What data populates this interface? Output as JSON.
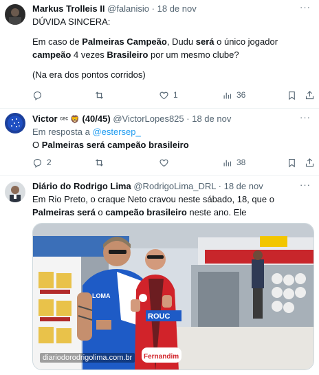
{
  "tweets": [
    {
      "author_name": "Markus Trolleis II",
      "handle": "@falanisio",
      "date": "18 de nov",
      "body_line1": "DÚVIDA SINCERA:",
      "body_p2_a": "Em caso de ",
      "body_p2_b": "Palmeiras Campeão",
      "body_p2_c": ", Dudu ",
      "body_p2_d": "será",
      "body_p2_e": " o único jogador ",
      "body_p2_f": "campeão",
      "body_p2_g": " 4 vezes ",
      "body_p2_h": "Brasileiro",
      "body_p2_i": " por um mesmo clube?",
      "body_p3": "(Na era dos pontos corridos)",
      "replies": "",
      "retweets": "",
      "likes": "1",
      "views": "36"
    },
    {
      "author_name": "Victor",
      "badge_emoji": "ᶜᵉᶜ 🦁",
      "badge_count": "(40/45)",
      "handle": "@VictorLopes825",
      "date": "18 de nov",
      "reply_prefix": "Em resposta a ",
      "reply_to": "@estersep_",
      "body_a": "O ",
      "body_b": "Palmeiras será campeão brasileiro",
      "replies": "2",
      "retweets": "",
      "likes": "",
      "views": "38"
    },
    {
      "author_name": "Diário do Rodrigo Lima",
      "handle": "@RodrigoLima_DRL",
      "date": "18 de nov",
      "body_a": "Em Rio Preto, o craque Neto cravou neste sábado, 18, que o ",
      "body_b": "Palmeiras",
      "body_c": " será",
      "body_d": " o ",
      "body_e": "campeão brasileiro",
      "body_f": " neste ano. Ele",
      "media_watermark": "diariodorodrigolima.com.br",
      "shirt_text": "ROUC",
      "shirt_logo": "Fernandim"
    }
  ],
  "colors": {
    "accent": "#1d9bf0",
    "secondary_text": "#536471",
    "divider": "#eff3f4"
  }
}
